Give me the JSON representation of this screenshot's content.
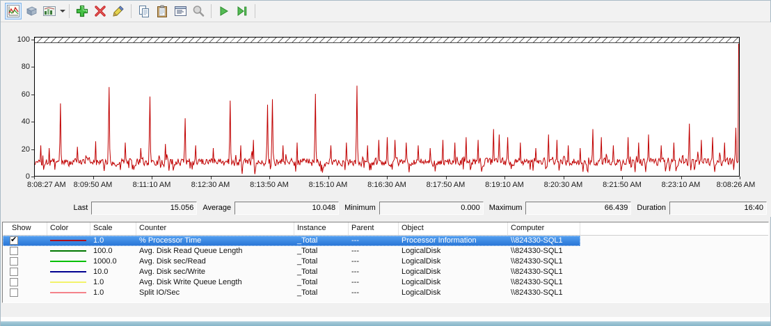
{
  "toolbar": {
    "icons": [
      {
        "name": "view-current-activity-icon",
        "selected": true
      },
      {
        "name": "view-log-data-icon"
      },
      {
        "name": "change-graph-type-icon",
        "has_dropdown": true
      },
      {
        "name": "add-counter-icon"
      },
      {
        "name": "delete-counter-icon"
      },
      {
        "name": "highlight-icon"
      },
      {
        "name": "copy-properties-icon"
      },
      {
        "name": "paste-counter-list-icon"
      },
      {
        "name": "properties-icon"
      },
      {
        "name": "zoom-icon"
      },
      {
        "name": "unfreeze-display-icon"
      },
      {
        "name": "update-data-icon"
      }
    ],
    "accent_green": "#2fae2f",
    "accent_red": "#d42b2b"
  },
  "chart_data": {
    "type": "line",
    "title": "",
    "xlabel": "",
    "ylabel": "",
    "y_axis": {
      "min": 0,
      "max": 100,
      "ticks": [
        0,
        20,
        40,
        60,
        80,
        100
      ]
    },
    "x_ticks": [
      "8:08:27 AM",
      "8:09:50 AM",
      "8:11:10 AM",
      "8:12:30 AM",
      "8:13:50 AM",
      "8:15:10 AM",
      "8:16:30 AM",
      "8:17:50 AM",
      "8:19:10 AM",
      "8:20:30 AM",
      "8:21:50 AM",
      "8:23:10 AM",
      "8:08:26 AM"
    ],
    "grid": false,
    "legend_position": "table-below",
    "series": [
      {
        "name": "% Processor Time",
        "color": "#c00000",
        "scale": "1.0"
      }
    ],
    "samples": 1000,
    "baseline": {
      "mean": 8.5,
      "noise": 4
    },
    "spikes": [
      [
        0.008,
        22
      ],
      [
        0.02,
        20
      ],
      [
        0.036,
        53
      ],
      [
        0.06,
        21
      ],
      [
        0.086,
        25
      ],
      [
        0.105,
        65
      ],
      [
        0.128,
        24
      ],
      [
        0.15,
        20
      ],
      [
        0.163,
        58
      ],
      [
        0.185,
        23
      ],
      [
        0.213,
        42
      ],
      [
        0.228,
        22
      ],
      [
        0.253,
        20
      ],
      [
        0.277,
        55
      ],
      [
        0.292,
        22
      ],
      [
        0.31,
        26
      ],
      [
        0.33,
        52
      ],
      [
        0.337,
        56
      ],
      [
        0.352,
        22
      ],
      [
        0.372,
        24
      ],
      [
        0.398,
        60
      ],
      [
        0.42,
        22
      ],
      [
        0.442,
        24
      ],
      [
        0.457,
        66
      ],
      [
        0.472,
        22
      ],
      [
        0.488,
        26
      ],
      [
        0.5,
        28
      ],
      [
        0.512,
        26
      ],
      [
        0.528,
        24
      ],
      [
        0.545,
        22
      ],
      [
        0.562,
        20
      ],
      [
        0.58,
        26
      ],
      [
        0.597,
        24
      ],
      [
        0.613,
        28
      ],
      [
        0.63,
        26
      ],
      [
        0.652,
        34
      ],
      [
        0.66,
        30
      ],
      [
        0.672,
        28
      ],
      [
        0.69,
        24
      ],
      [
        0.712,
        20
      ],
      [
        0.73,
        30
      ],
      [
        0.742,
        26
      ],
      [
        0.758,
        22
      ],
      [
        0.775,
        20
      ],
      [
        0.793,
        34
      ],
      [
        0.805,
        28
      ],
      [
        0.822,
        22
      ],
      [
        0.843,
        28
      ],
      [
        0.858,
        24
      ],
      [
        0.872,
        30
      ],
      [
        0.89,
        22
      ],
      [
        0.908,
        24
      ],
      [
        0.93,
        38
      ],
      [
        0.947,
        26
      ],
      [
        0.963,
        28
      ],
      [
        0.98,
        24
      ],
      [
        0.996,
        35
      ]
    ],
    "last_sample_value": 97
  },
  "stats": {
    "last_label": "Last",
    "last": "15.056",
    "average_label": "Average",
    "average": "10.048",
    "minimum_label": "Minimum",
    "minimum": "0.000",
    "maximum_label": "Maximum",
    "maximum": "66.439",
    "duration_label": "Duration",
    "duration": "16:40"
  },
  "legend": {
    "columns": [
      "Show",
      "Color",
      "Scale",
      "Counter",
      "Instance",
      "Parent",
      "Object",
      "Computer"
    ],
    "rows": [
      {
        "checked": true,
        "selected": true,
        "color": "#b00e1c",
        "scale": "1.0",
        "counter": "% Processor Time",
        "instance": "_Total",
        "parent": "---",
        "object": "Processor Information",
        "computer": "\\\\824330-SQL1"
      },
      {
        "checked": false,
        "selected": false,
        "color": "#007700",
        "scale": "100.0",
        "counter": "Avg. Disk Read Queue Length",
        "instance": "_Total",
        "parent": "---",
        "object": "LogicalDisk",
        "computer": "\\\\824330-SQL1"
      },
      {
        "checked": false,
        "selected": false,
        "color": "#00c000",
        "scale": "1000.0",
        "counter": "Avg. Disk sec/Read",
        "instance": "_Total",
        "parent": "---",
        "object": "LogicalDisk",
        "computer": "\\\\824330-SQL1"
      },
      {
        "checked": false,
        "selected": false,
        "color": "#000090",
        "scale": "10.0",
        "counter": "Avg. Disk sec/Write",
        "instance": "_Total",
        "parent": "---",
        "object": "LogicalDisk",
        "computer": "\\\\824330-SQL1"
      },
      {
        "checked": false,
        "selected": false,
        "color": "#f3f36a",
        "scale": "1.0",
        "counter": "Avg. Disk Write Queue Length",
        "instance": "_Total",
        "parent": "---",
        "object": "LogicalDisk",
        "computer": "\\\\824330-SQL1"
      },
      {
        "checked": false,
        "selected": false,
        "color": "#f4828a",
        "scale": "1.0",
        "counter": "Split IO/Sec",
        "instance": "_Total",
        "parent": "---",
        "object": "LogicalDisk",
        "computer": "\\\\824330-SQL1"
      }
    ]
  }
}
